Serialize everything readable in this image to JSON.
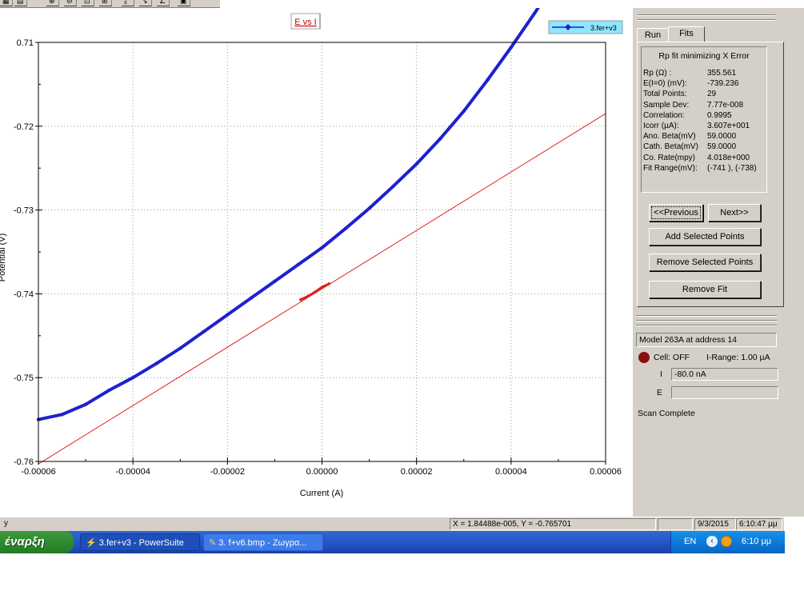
{
  "chart_data": {
    "type": "scatter",
    "title": "E vs I",
    "xlabel": "Current (A)",
    "ylabel": "Potential (V)",
    "xlim": [
      -6e-05,
      6e-05
    ],
    "ylim": [
      -0.76,
      0.71
    ],
    "x_ticks": [
      "-0.00006",
      "-0.00004",
      "-0.00002",
      "0.00000",
      "0.00002",
      "0.00004",
      "0.00006"
    ],
    "y_ticks": [
      "0.71",
      "-0.72",
      "-0.73",
      "-0.74",
      "-0.75",
      "-0.76"
    ],
    "grid": true,
    "legend_position": "top-right",
    "series": [
      {
        "name": "3.fer+v3",
        "color": "#1f1fd0",
        "points": [
          [
            -6e-05,
            -0.755
          ],
          [
            -5.5e-05,
            -0.7544
          ],
          [
            -5e-05,
            -0.7532
          ],
          [
            -4.5e-05,
            -0.7515
          ],
          [
            -4e-05,
            -0.75
          ],
          [
            -3.5e-05,
            -0.7483
          ],
          [
            -3e-05,
            -0.7465
          ],
          [
            -2.5e-05,
            -0.7445
          ],
          [
            -2e-05,
            -0.7425
          ],
          [
            -1.5e-05,
            -0.7405
          ],
          [
            -1e-05,
            -0.7385
          ],
          [
            -5e-06,
            -0.7365
          ],
          [
            0.0,
            -0.7345
          ],
          [
            5e-06,
            -0.7322
          ],
          [
            1e-05,
            -0.7298
          ],
          [
            1.5e-05,
            -0.7272
          ],
          [
            2e-05,
            -0.7245
          ],
          [
            2.5e-05,
            -0.7215
          ],
          [
            3e-05,
            -0.7182
          ],
          [
            3.5e-05,
            -0.7145
          ],
          [
            4e-05,
            -0.7106
          ],
          [
            4.5e-05,
            -0.7065
          ],
          [
            5e-05,
            -0.7022
          ],
          [
            5.5e-05,
            -0.6985
          ]
        ]
      },
      {
        "name": "fit-points",
        "color": "#e02020",
        "points": [
          [
            -4.5e-06,
            -0.7407
          ],
          [
            -3e-06,
            -0.7403
          ],
          [
            -1.5e-06,
            -0.7398
          ],
          [
            0.0,
            -0.7392
          ],
          [
            1.5e-06,
            -0.7388
          ]
        ]
      },
      {
        "name": "fit-line",
        "color": "#e02020",
        "line": [
          [
            -6e-05,
            -0.7603
          ],
          [
            6e-05,
            -0.7185
          ]
        ]
      }
    ]
  },
  "tabs": {
    "run": "Run",
    "fits": "Fits"
  },
  "fit": {
    "title": "Rp fit minimizing X Error",
    "rows": [
      {
        "label": "Rp (Ω) :",
        "value": "355.561"
      },
      {
        "label": "E(I=0) (mV):",
        "value": "-739.236"
      },
      {
        "label": "Total Points:",
        "value": "29"
      },
      {
        "label": "Sample Dev:",
        "value": "7.77e-008"
      },
      {
        "label": "Correlation:",
        "value": "0.9995"
      },
      {
        "label": "Icorr (µA):",
        "value": "3.607e+001"
      },
      {
        "label": "Ano. Beta(mV)",
        "value": "59.0000"
      },
      {
        "label": "Cath. Beta(mV)",
        "value": "59.0000"
      },
      {
        "label": "Co. Rate(mpy)",
        "value": "4.018e+000"
      },
      {
        "label": "Fit Range(mV):",
        "value": "(-741 ), (-738)"
      }
    ]
  },
  "buttons": {
    "previous": "<<Previous",
    "next": "Next>>",
    "add_selected": "Add Selected Points",
    "remove_selected": "Remove Selected Points",
    "remove_fit": "Remove Fit"
  },
  "instrument": {
    "model": "Model 263A at address 14",
    "cell": "Cell: OFF",
    "i_range": "I-Range: 1.00 µA",
    "i_label": "I",
    "i_value": "-80.0 nA",
    "e_label": "E",
    "e_value": "",
    "scan_status": "Scan Complete",
    "cell_color": "#8b1010"
  },
  "status_bar": {
    "left": "y",
    "coords": "X = 1.84488e-005, Y = -0.765701",
    "date": "9/3/2015",
    "time": "6:10:47 μμ"
  },
  "taskbar": {
    "start": "έναρξη",
    "task1": "3.fer+v3 - PowerSuite",
    "task2": "3. f+v6.bmp - Ζωγρα...",
    "lang": "EN",
    "clock": "6:10 μμ"
  }
}
